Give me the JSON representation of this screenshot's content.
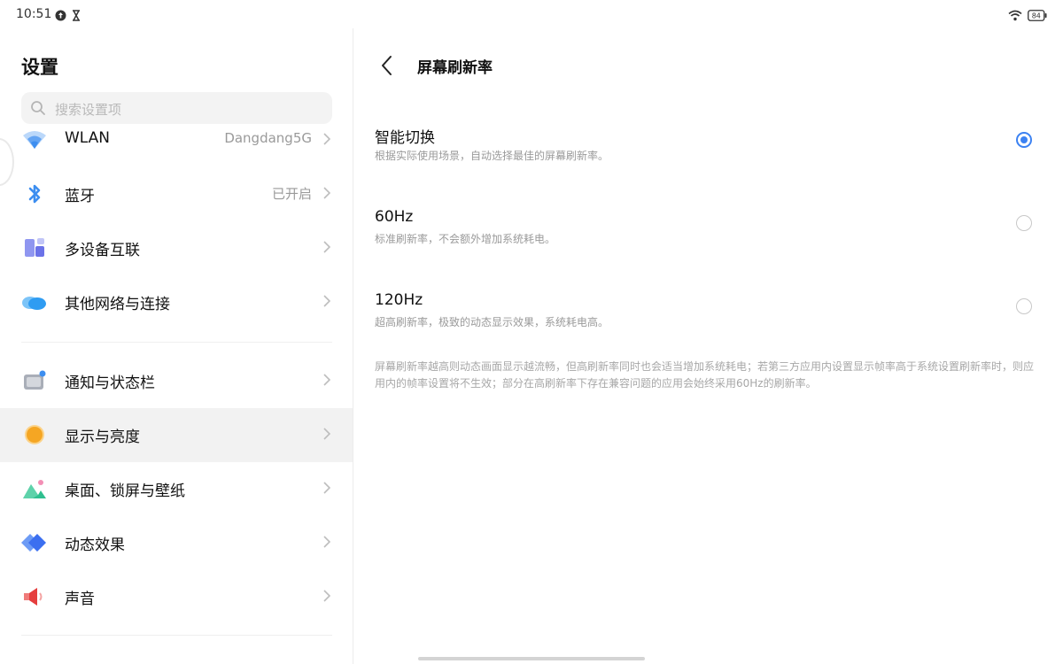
{
  "status": {
    "time": "10:51",
    "battery": "84"
  },
  "left": {
    "title": "设置",
    "search_placeholder": "搜索设置项",
    "items": [
      {
        "label": "WLAN",
        "value": "Dangdang5G",
        "icon": "wifi-icon",
        "color": "#3d8ef0"
      },
      {
        "label": "蓝牙",
        "value": "已开启",
        "icon": "bluetooth-icon",
        "color": "#3d8ef0"
      },
      {
        "label": "多设备互联",
        "value": "",
        "icon": "multi-device-icon",
        "color": "#6b72e8"
      },
      {
        "label": "其他网络与连接",
        "value": "",
        "icon": "cloud-icon",
        "color": "#2f9cf2"
      },
      {
        "label": "通知与状态栏",
        "value": "",
        "icon": "notification-icon",
        "color": "#8a8f9a"
      },
      {
        "label": "显示与亮度",
        "value": "",
        "icon": "brightness-icon",
        "color": "#f5a623"
      },
      {
        "label": "桌面、锁屏与壁纸",
        "value": "",
        "icon": "wallpaper-icon",
        "color": "#2fbf8f"
      },
      {
        "label": "动态效果",
        "value": "",
        "icon": "animation-icon",
        "color": "#3b6ff0"
      },
      {
        "label": "声音",
        "value": "",
        "icon": "sound-icon",
        "color": "#ef5350"
      }
    ]
  },
  "right": {
    "page_title": "屏幕刷新率",
    "options": [
      {
        "title": "智能切换",
        "desc": "根据实际使用场景，自动选择最佳的屏幕刷新率。",
        "checked": true
      },
      {
        "title": "60Hz",
        "desc": "标准刷新率，不会额外增加系统耗电。",
        "checked": false
      },
      {
        "title": "120Hz",
        "desc": "超高刷新率，极致的动态显示效果，系统耗电高。",
        "checked": false
      }
    ],
    "footnote": "屏幕刷新率越高则动态画面显示越流畅，但高刷新率同时也会适当增加系统耗电；若第三方应用内设置显示帧率高于系统设置刷新率时，则应用内的帧率设置将不生效；部分在高刷新率下存在兼容问题的应用会始终采用60Hz的刷新率。"
  },
  "colors": {
    "accent": "#3c82f2",
    "active_row": "#f2f2f2"
  }
}
